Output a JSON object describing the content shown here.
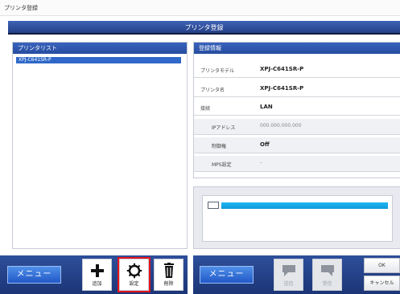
{
  "window": {
    "title": "プリンタ登録"
  },
  "header": {
    "title": "プリンタ登録"
  },
  "printer_list": {
    "title": "プリンタリスト",
    "items": [
      {
        "label": "XPJ-C641SR-P"
      }
    ]
  },
  "printer_info": {
    "title": "登録情報",
    "rows": [
      {
        "label": "プリンタモデル",
        "value": "XPJ-C641SR-P"
      },
      {
        "label": "プリンタ名",
        "value": "XPJ-C641SR-P"
      },
      {
        "label": "接続",
        "value": "LAN"
      },
      {
        "label": "IPアドレス",
        "value": "000.000.000.000"
      },
      {
        "label": "制御権",
        "value": "Off"
      },
      {
        "label": "MPS設定",
        "value": "–"
      }
    ]
  },
  "status": {
    "progress": 1.0,
    "color": "#1aaaeb"
  },
  "toolbar_left": {
    "menu_label": "メニュー",
    "buttons": [
      {
        "icon": "plus-icon",
        "label": "追加"
      },
      {
        "icon": "gear-icon",
        "label": "設定"
      },
      {
        "icon": "trash-icon",
        "label": "削除"
      }
    ]
  },
  "toolbar_right": {
    "menu_label": "メニュー",
    "buttons": [
      {
        "icon": "speech-bubble-icon",
        "label": "送信"
      },
      {
        "icon": "speech-bubble-icon",
        "label": "受信"
      }
    ],
    "ok_label": "OK",
    "cancel_label": "キャンセル"
  },
  "colors": {
    "accent": "#2f68c8",
    "highlight": "#e0141c",
    "toolbar": "#24428a"
  }
}
